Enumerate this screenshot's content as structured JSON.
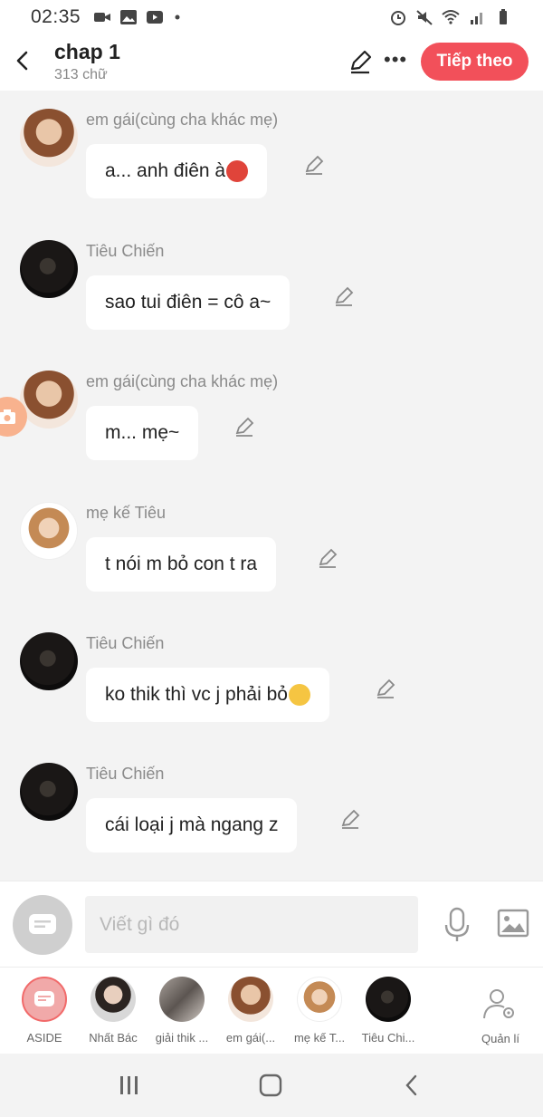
{
  "status_bar": {
    "time": "02:35"
  },
  "header": {
    "title": "chap 1",
    "word_count": "313 chữ",
    "next_label": "Tiếp theo"
  },
  "messages": [
    {
      "sender": "em gái(cùng cha khác mẹ)",
      "text": "a... anh điên à",
      "avatar": "girl-avatar",
      "emoji": "angry"
    },
    {
      "sender": "Tiêu Chiến",
      "text": "sao tui điên = cô a~",
      "avatar": "dark-avatar"
    },
    {
      "sender": "em gái(cùng cha khác mẹ)",
      "text": "m... mẹ~",
      "avatar": "girl-avatar"
    },
    {
      "sender": "mẹ kế Tiêu",
      "text": "t nói m bỏ con t ra",
      "avatar": "mom-avatar"
    },
    {
      "sender": "Tiêu Chiến",
      "text": "ko thik thì vc j phải bỏ",
      "avatar": "dark-avatar",
      "emoji": "smile"
    },
    {
      "sender": "Tiêu Chiến",
      "text": "cái loại j mà ngang z",
      "avatar": "dark-avatar"
    }
  ],
  "input": {
    "placeholder": "Viết gì đó"
  },
  "characters": [
    {
      "label": "ASIDE"
    },
    {
      "label": "Nhất Bác"
    },
    {
      "label": "giải thik ..."
    },
    {
      "label": "em gái(..."
    },
    {
      "label": "mẹ kế T..."
    },
    {
      "label": "Tiêu Chi..."
    }
  ],
  "manage_label": "Quản lí",
  "colors": {
    "accent": "#f2505a",
    "background": "#f3f3f3"
  }
}
